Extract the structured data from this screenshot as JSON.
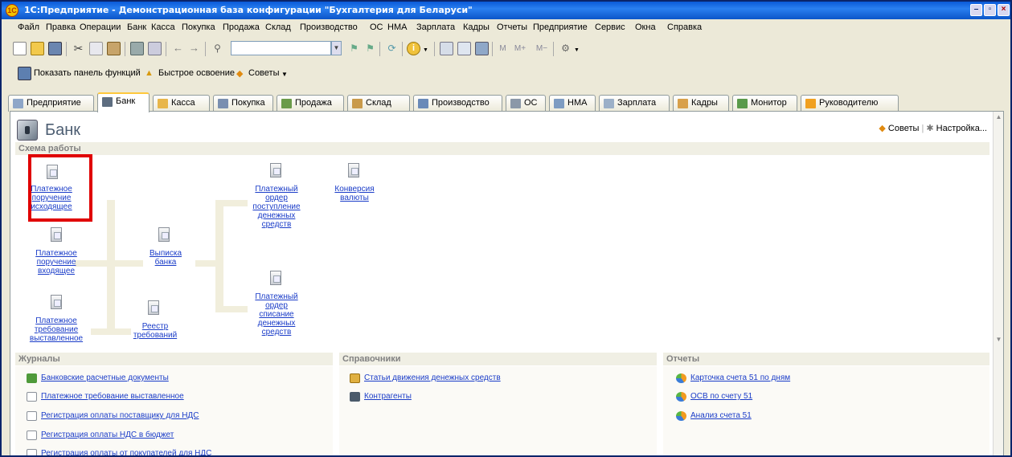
{
  "window": {
    "title": "1С:Предприятие - Демонстрационная база конфигурации \"Бухгалтерия для Беларуси\""
  },
  "menu": [
    "Файл",
    "Правка",
    "Операции",
    "Банк",
    "Касса",
    "Покупка",
    "Продажа",
    "Склад",
    "Производство",
    "ОС",
    "НМА",
    "Зарплата",
    "Кадры",
    "Отчеты",
    "Предприятие",
    "Сервис",
    "Окна",
    "Справка"
  ],
  "funcbar": {
    "show_panel": "Показать панель функций",
    "quick_learning": "Быстрое освоение",
    "tips": "Советы"
  },
  "tabs": [
    "Предприятие",
    "Банк",
    "Касса",
    "Покупка",
    "Продажа",
    "Склад",
    "Производство",
    "ОС",
    "НМА",
    "Зарплата",
    "Кадры",
    "Монитор",
    "Руководителю"
  ],
  "active_tab": "Банк",
  "page": {
    "title": "Банк",
    "tips_link": "Советы",
    "settings_link": "Настройка..."
  },
  "scheme": {
    "header": "Схема работы",
    "items": {
      "pp_out": "Платежное поручение исходящее",
      "pp_in": "Платежное поручение входящее",
      "pt_out": "Платежное требование выставленное",
      "statement": "Выписка банка",
      "register": "Реестр требований",
      "po_in": "Платежный ордер поступление денежных средств",
      "po_out": "Платежный ордер списание денежных средств",
      "conversion": "Конверсия валюты"
    }
  },
  "journals": {
    "header": "Журналы",
    "items": [
      "Банковские расчетные документы",
      "Платежное требование выставленное",
      "Регистрация оплаты поставщику для НДС",
      "Регистрация оплаты НДС в бюджет",
      "Регистрация оплаты от покупателей для НДС"
    ]
  },
  "references": {
    "header": "Справочники",
    "items": [
      "Статьи движения денежных средств",
      "Контрагенты"
    ]
  },
  "reports": {
    "header": "Отчеты",
    "items": [
      "Карточка счета 51 по дням",
      "ОСВ по счету 51",
      "Анализ счета 51"
    ]
  },
  "colors": {
    "title_bar": "#0a5ad8",
    "link": "#1a3cc8",
    "highlight": "#e00000"
  }
}
